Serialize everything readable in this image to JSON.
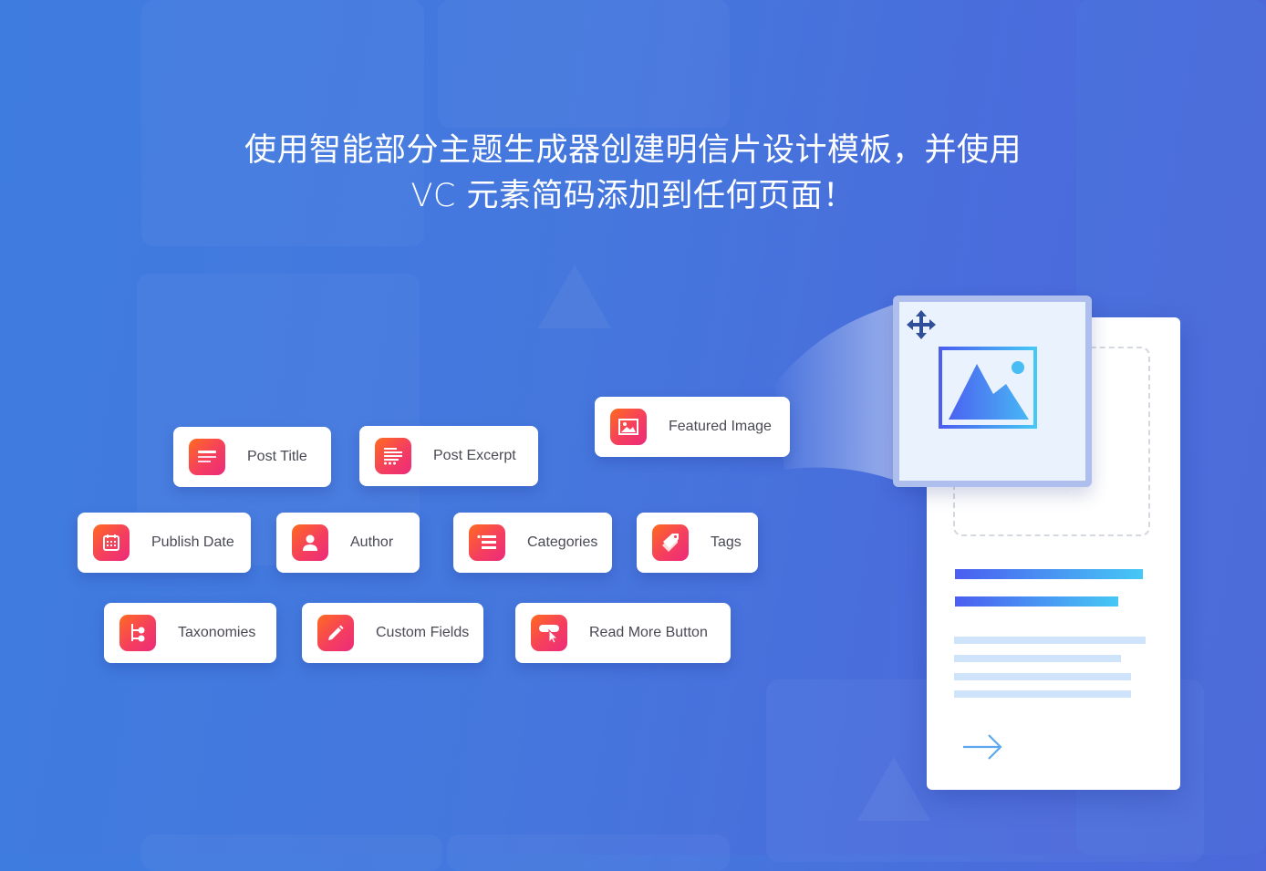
{
  "headline": {
    "line1": "使用智能部分主题生成器创建明信片设计模板，并使用",
    "line2": "VC 元素简码添加到任何页面！"
  },
  "elements": [
    {
      "label": "Post Title",
      "icon": "post-title-icon"
    },
    {
      "label": "Post Excerpt",
      "icon": "post-excerpt-icon"
    },
    {
      "label": "Featured Image",
      "icon": "featured-image-icon"
    },
    {
      "label": "Publish Date",
      "icon": "calendar-icon"
    },
    {
      "label": "Author",
      "icon": "user-icon"
    },
    {
      "label": "Categories",
      "icon": "list-icon"
    },
    {
      "label": "Tags",
      "icon": "tags-icon"
    },
    {
      "label": "Taxonomies",
      "icon": "hierarchy-icon"
    },
    {
      "label": "Custom Fields",
      "icon": "pencil-icon"
    },
    {
      "label": "Read More Button",
      "icon": "cursor-button-icon"
    }
  ],
  "preview": {
    "drag_icon": "move-icon",
    "image_icon": "image-placeholder-icon",
    "arrow_icon": "arrow-right-icon"
  },
  "colors": {
    "background": "#4577dd",
    "icon_gradient_start": "#ff6b1f",
    "icon_gradient_end": "#ec2a7a",
    "accent_bar_start": "#4b5ef0",
    "accent_bar_end": "#46c8f5"
  }
}
